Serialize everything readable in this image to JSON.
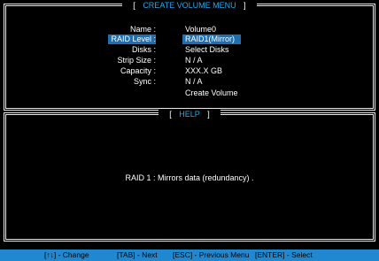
{
  "create_menu": {
    "title": "CREATE VOLUME MENU",
    "fields": [
      {
        "label": "Name :",
        "value": "Volume0"
      },
      {
        "label": "RAID Level :",
        "value": "RAID1(Mirror)"
      },
      {
        "label": "Disks :",
        "value": "Select  Disks"
      },
      {
        "label": "Strip Size :",
        "value": "N / A"
      },
      {
        "label": "Capacity :",
        "value": "XXX.X  GB"
      },
      {
        "label": "Sync :",
        "value": "N / A"
      }
    ],
    "create_button": "Create Volume"
  },
  "help": {
    "title": "HELP",
    "text": "RAID  1 : Mirrors  data  (redundancy) ."
  },
  "status_bar": {
    "change": "[↑↓] - Change",
    "next": "[TAB] - Next",
    "previous": "[ESC] - Previous Menu",
    "select": "[ENTER] - Select"
  },
  "colors": {
    "title_text": "#22a8ee",
    "highlight": "#1e6fb0",
    "status_bar": "#1f88d0"
  }
}
